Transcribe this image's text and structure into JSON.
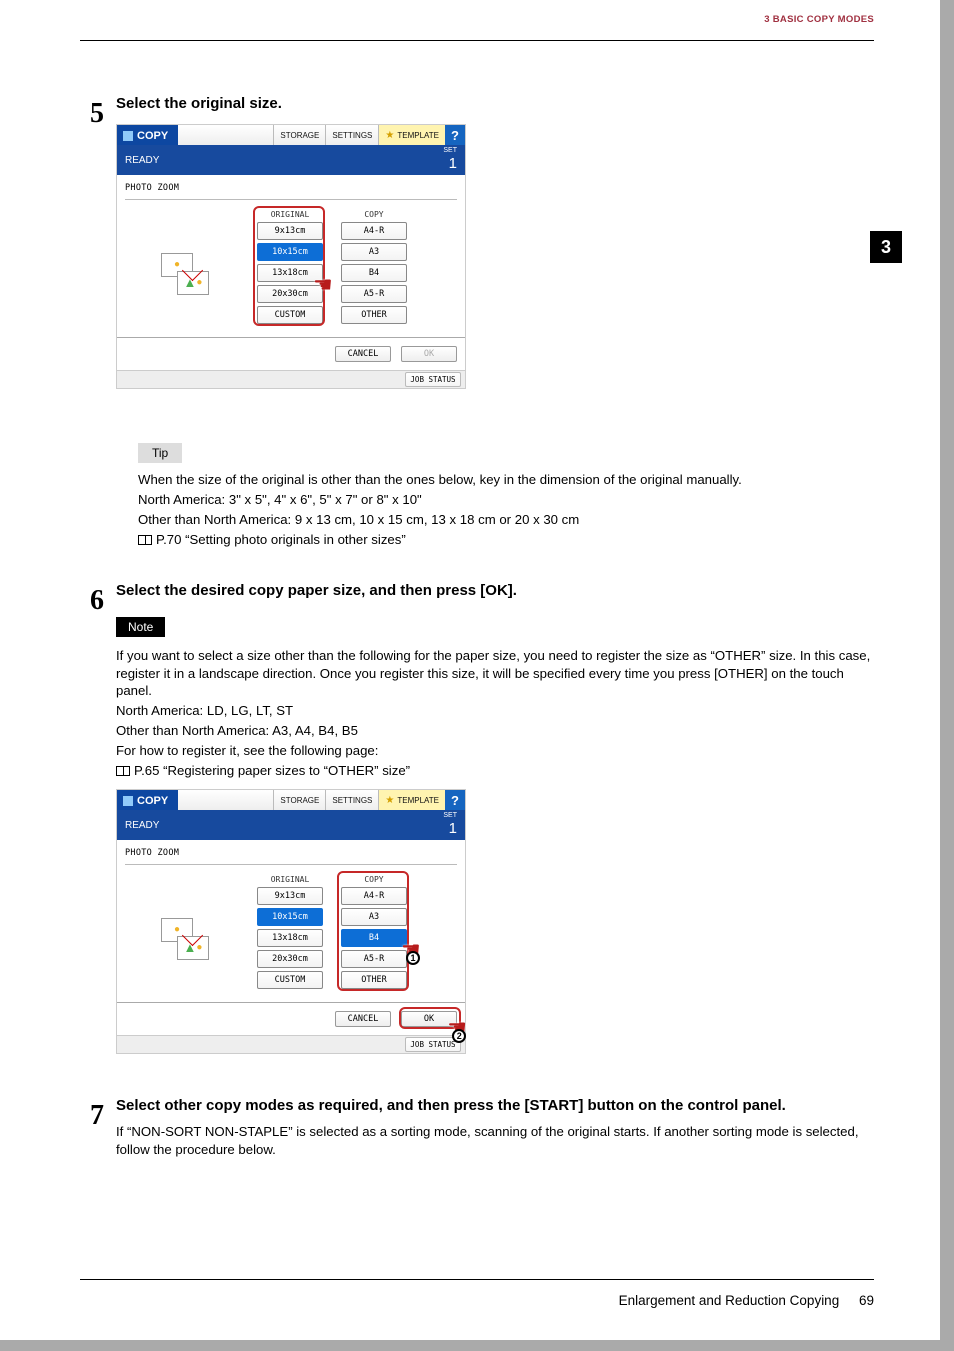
{
  "header": {
    "title": "3 BASIC COPY MODES"
  },
  "chapter_tab": "3",
  "steps": {
    "s5": {
      "num": "5",
      "title": "Select the original size.",
      "tip_label": "Tip",
      "tip_p1": "When the size of the original is other than the ones below, key in the dimension of the original manually.",
      "tip_p2": "North America: 3\" x 5\", 4\" x 6\", 5\" x 7\" or 8\" x 10\"",
      "tip_p3": "Other than North America: 9 x 13 cm, 10 x 15 cm, 13 x 18 cm or 20 x 30 cm",
      "tip_ref": "P.70 “Setting photo originals in other sizes”"
    },
    "s6": {
      "num": "6",
      "title": "Select the desired copy paper size, and then press [OK].",
      "note_label": "Note",
      "note_p1": "If you want to select a size other than the following for the paper size, you need to register the size as “OTHER” size. In this case, register it in a landscape direction. Once you register this size, it will be specified every time you press [OTHER] on the touch panel.",
      "note_p2": "North America: LD, LG, LT, ST",
      "note_p3": "Other than North America: A3, A4, B4, B5",
      "note_p4": "For how to register it, see the following page:",
      "note_ref": "P.65 “Registering paper sizes to “OTHER” size”"
    },
    "s7": {
      "num": "7",
      "title": "Select other copy modes as required, and then press the [START] button on the control panel.",
      "text": "If “NON-SORT NON-STAPLE” is selected as a sorting mode, scanning of the original starts. If another sorting mode is selected, follow the procedure below."
    }
  },
  "ui": {
    "brand": "COPY",
    "storage": "STORAGE",
    "settings": "SETTINGS",
    "template": "TEMPLATE",
    "help": "?",
    "ready": "READY",
    "set": "SET",
    "set_num": "1",
    "crumb": "PHOTO ZOOM",
    "original_head": "ORIGINAL",
    "copy_head": "COPY",
    "orig": [
      "9x13cm",
      "10x15cm",
      "13x18cm",
      "20x30cm",
      "CUSTOM"
    ],
    "copy": [
      "A4-R",
      "A3",
      "B4",
      "A5-R",
      "OTHER"
    ],
    "cancel": "CANCEL",
    "ok": "OK",
    "job": "JOB STATUS"
  },
  "footer": {
    "section": "Enlargement and Reduction Copying",
    "page": "69"
  }
}
